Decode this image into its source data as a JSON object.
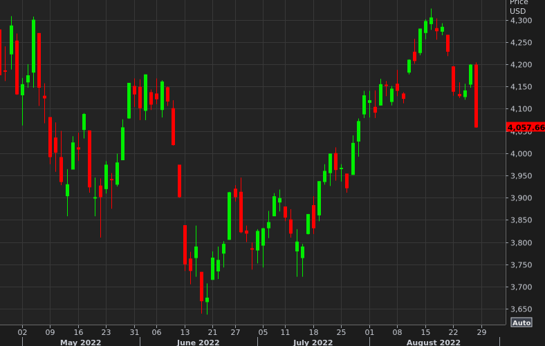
{
  "chart_data": {
    "type": "candlestick",
    "title": "",
    "ylabel": "Price USD",
    "y_header": [
      "Price",
      "USD"
    ],
    "ylim": [
      3630,
      4344
    ],
    "y_ticks": [
      4300,
      4250,
      4200,
      4150,
      4100,
      4050,
      4000,
      3950,
      3900,
      3850,
      3800,
      3750,
      3700,
      3650
    ],
    "y_tick_labels": [
      "4,300",
      "4,250",
      "4,200",
      "4,150",
      "4,100",
      "4,050",
      "4,000",
      "3,950",
      "3,900",
      "3,850",
      "3,800",
      "3,750",
      "3,700",
      "3,650"
    ],
    "grid": true,
    "last_price_label": "4,057.66",
    "auto_button": "Auto",
    "colors": {
      "up": "#00ee00",
      "down": "#ff0000",
      "background": "#232323",
      "grid": "#383838",
      "last_price_bg": "#ff0000"
    },
    "x_ticks": [
      {
        "label": "02",
        "date": "2022-05-02"
      },
      {
        "label": "09",
        "date": "2022-05-09"
      },
      {
        "label": "16",
        "date": "2022-05-16"
      },
      {
        "label": "23",
        "date": "2022-05-23"
      },
      {
        "label": "31",
        "date": "2022-05-31"
      },
      {
        "label": "06",
        "date": "2022-06-06"
      },
      {
        "label": "13",
        "date": "2022-06-13"
      },
      {
        "label": "21",
        "date": "2022-06-21"
      },
      {
        "label": "27",
        "date": "2022-06-27"
      },
      {
        "label": "05",
        "date": "2022-07-05"
      },
      {
        "label": "11",
        "date": "2022-07-11"
      },
      {
        "label": "18",
        "date": "2022-07-18"
      },
      {
        "label": "25",
        "date": "2022-07-25"
      },
      {
        "label": "01",
        "date": "2022-08-01"
      },
      {
        "label": "08",
        "date": "2022-08-08"
      },
      {
        "label": "15",
        "date": "2022-08-15"
      },
      {
        "label": "22",
        "date": "2022-08-22"
      },
      {
        "label": "29",
        "date": "2022-08-29"
      }
    ],
    "months": [
      {
        "label": "May 2022",
        "start": "2022-05-02",
        "end": "2022-06-01"
      },
      {
        "label": "June 2022",
        "start": "2022-06-01",
        "end": "2022-07-01"
      },
      {
        "label": "July 2022",
        "start": "2022-07-01",
        "end": "2022-08-01"
      },
      {
        "label": "August 2022",
        "start": "2022-08-01",
        "end": "2022-09-01"
      }
    ],
    "columns": [
      "date",
      "open",
      "high",
      "low",
      "close"
    ],
    "candles": [
      [
        "2022-04-26",
        4278,
        4279,
        4175,
        4175
      ],
      [
        "2022-04-27",
        4186,
        4240,
        4162,
        4183
      ],
      [
        "2022-04-28",
        4222,
        4308,
        4188,
        4287
      ],
      [
        "2022-04-29",
        4253,
        4269,
        4131,
        4132
      ],
      [
        "2022-05-02",
        4130,
        4169,
        4062,
        4155
      ],
      [
        "2022-05-03",
        4159,
        4200,
        4147,
        4175
      ],
      [
        "2022-05-04",
        4181,
        4307,
        4147,
        4300
      ],
      [
        "2022-05-05",
        4270,
        4270,
        4106,
        4147
      ],
      [
        "2022-05-06",
        4129,
        4157,
        4067,
        4123
      ],
      [
        "2022-05-09",
        4081,
        4081,
        3975,
        3991
      ],
      [
        "2022-05-10",
        4035,
        4069,
        3958,
        4001
      ],
      [
        "2022-05-11",
        3991,
        4050,
        3928,
        3935
      ],
      [
        "2022-05-12",
        3903,
        3964,
        3858,
        3930
      ],
      [
        "2022-05-13",
        3963,
        4038,
        3963,
        4024
      ],
      [
        "2022-05-16",
        4013,
        4046,
        3983,
        4008
      ],
      [
        "2022-05-17",
        4052,
        4090,
        4033,
        4088
      ],
      [
        "2022-05-18",
        4051,
        4051,
        3911,
        3923
      ],
      [
        "2022-05-19",
        3900,
        3945,
        3858,
        3901
      ],
      [
        "2022-05-20",
        3927,
        3943,
        3810,
        3901
      ],
      [
        "2022-05-23",
        3919,
        3982,
        3909,
        3974
      ],
      [
        "2022-05-24",
        3942,
        3955,
        3875,
        3941
      ],
      [
        "2022-05-25",
        3929,
        3999,
        3925,
        3979
      ],
      [
        "2022-05-26",
        3984,
        4076,
        3984,
        4058
      ],
      [
        "2022-05-27",
        4078,
        4158,
        4077,
        4158
      ],
      [
        "2022-05-31",
        4151,
        4168,
        4104,
        4132
      ],
      [
        "2022-06-01",
        4149,
        4166,
        4074,
        4101
      ],
      [
        "2022-06-02",
        4095,
        4177,
        4074,
        4177
      ],
      [
        "2022-06-03",
        4137,
        4143,
        4097,
        4109
      ],
      [
        "2022-06-06",
        4134,
        4168,
        4110,
        4121
      ],
      [
        "2022-06-07",
        4097,
        4164,
        4080,
        4161
      ],
      [
        "2022-06-08",
        4148,
        4150,
        4106,
        4116
      ],
      [
        "2022-06-09",
        4101,
        4119,
        4017,
        4018
      ],
      [
        "2022-06-10",
        3974,
        3974,
        3900,
        3901
      ],
      [
        "2022-06-13",
        3838,
        3838,
        3735,
        3750
      ],
      [
        "2022-06-14",
        3763,
        3778,
        3705,
        3735
      ],
      [
        "2022-06-15",
        3764,
        3837,
        3722,
        3790
      ],
      [
        "2022-06-16",
        3733,
        3733,
        3639,
        3667
      ],
      [
        "2022-06-17",
        3665,
        3707,
        3637,
        3675
      ],
      [
        "2022-06-21",
        3715,
        3779,
        3715,
        3765
      ],
      [
        "2022-06-22",
        3734,
        3790,
        3717,
        3760
      ],
      [
        "2022-06-23",
        3774,
        3802,
        3743,
        3796
      ],
      [
        "2022-06-24",
        3805,
        3913,
        3805,
        3912
      ],
      [
        "2022-06-27",
        3920,
        3928,
        3891,
        3901
      ],
      [
        "2022-06-28",
        3913,
        3945,
        3820,
        3822
      ],
      [
        "2022-06-29",
        3826,
        3837,
        3800,
        3819
      ],
      [
        "2022-06-30",
        3786,
        3799,
        3738,
        3785
      ],
      [
        "2022-07-01",
        3781,
        3829,
        3752,
        3825
      ],
      [
        "2022-07-05",
        3792,
        3832,
        3743,
        3831
      ],
      [
        "2022-07-06",
        3831,
        3870,
        3809,
        3845
      ],
      [
        "2022-07-07",
        3858,
        3910,
        3858,
        3903
      ],
      [
        "2022-07-08",
        3889,
        3918,
        3869,
        3899
      ],
      [
        "2022-07-11",
        3880,
        3880,
        3847,
        3855
      ],
      [
        "2022-07-12",
        3851,
        3874,
        3810,
        3819
      ],
      [
        "2022-07-13",
        3779,
        3829,
        3722,
        3801
      ],
      [
        "2022-07-14",
        3764,
        3796,
        3722,
        3790
      ],
      [
        "2022-07-15",
        3818,
        3863,
        3817,
        3863
      ],
      [
        "2022-07-18",
        3883,
        3903,
        3818,
        3831
      ],
      [
        "2022-07-19",
        3860,
        3937,
        3847,
        3937
      ],
      [
        "2022-07-20",
        3935,
        3975,
        3929,
        3960
      ],
      [
        "2022-07-21",
        3955,
        3999,
        3926,
        3999
      ],
      [
        "2022-07-22",
        4000,
        4013,
        3938,
        3962
      ],
      [
        "2022-07-25",
        3965,
        3975,
        3936,
        3967
      ],
      [
        "2022-07-26",
        3954,
        3954,
        3911,
        3921
      ],
      [
        "2022-07-27",
        3951,
        4040,
        3951,
        4023
      ],
      [
        "2022-07-28",
        4026,
        4078,
        3992,
        4072
      ],
      [
        "2022-07-29",
        4087,
        4140,
        4079,
        4130
      ],
      [
        "2022-08-01",
        4113,
        4140,
        4080,
        4119
      ],
      [
        "2022-08-02",
        4104,
        4141,
        4079,
        4091
      ],
      [
        "2022-08-03",
        4107,
        4167,
        4107,
        4155
      ],
      [
        "2022-08-04",
        4154,
        4162,
        4128,
        4152
      ],
      [
        "2022-08-05",
        4115,
        4151,
        4107,
        4145
      ],
      [
        "2022-08-08",
        4156,
        4187,
        4128,
        4140
      ],
      [
        "2022-08-09",
        4134,
        4137,
        4112,
        4122
      ],
      [
        "2022-08-10",
        4181,
        4211,
        4177,
        4210
      ],
      [
        "2022-08-11",
        4228,
        4257,
        4201,
        4207
      ],
      [
        "2022-08-12",
        4225,
        4280,
        4220,
        4280
      ],
      [
        "2022-08-15",
        4270,
        4301,
        4256,
        4297
      ],
      [
        "2022-08-16",
        4290,
        4325,
        4277,
        4305
      ],
      [
        "2022-08-17",
        4281,
        4303,
        4255,
        4274
      ],
      [
        "2022-08-18",
        4273,
        4292,
        4265,
        4284
      ],
      [
        "2022-08-19",
        4266,
        4266,
        4218,
        4228
      ],
      [
        "2022-08-22",
        4195,
        4196,
        4129,
        4138
      ],
      [
        "2022-08-23",
        4133,
        4159,
        4124,
        4128
      ],
      [
        "2022-08-24",
        4126,
        4156,
        4120,
        4141
      ],
      [
        "2022-08-25",
        4154,
        4200,
        4147,
        4199
      ],
      [
        "2022-08-26",
        4199,
        4204,
        4057,
        4057.66
      ]
    ]
  }
}
